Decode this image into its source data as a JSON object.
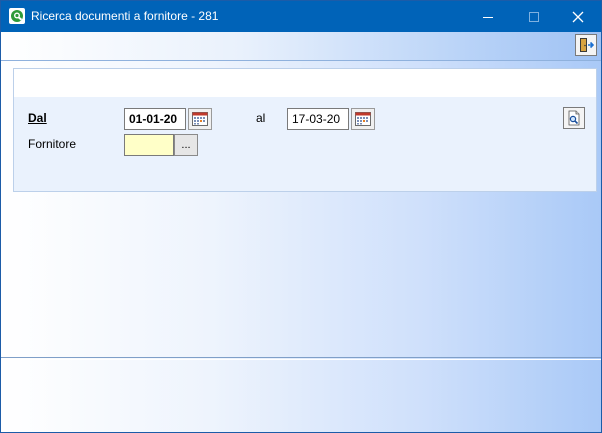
{
  "window": {
    "title": "Ricerca documenti a fornitore - 281",
    "icons": {
      "app": "q-logo-icon",
      "minimize": "minimize-icon",
      "maximize": "maximize-icon",
      "close": "close-icon"
    }
  },
  "toolbar": {
    "exit_icon": "exit-door-icon"
  },
  "form": {
    "dal_label": "Dal",
    "dal_value": "01-01-20",
    "al_label": "al",
    "al_value": "17-03-20",
    "fornitore_label": "Fornitore",
    "fornitore_value": "",
    "lookup_label": "...",
    "search_icon": "search-document-icon",
    "calendar_icon": "calendar-icon"
  },
  "colors": {
    "titlebar": "#0063b8",
    "fornitore_field": "#ffffc8",
    "panel": "#eaf2fd"
  }
}
